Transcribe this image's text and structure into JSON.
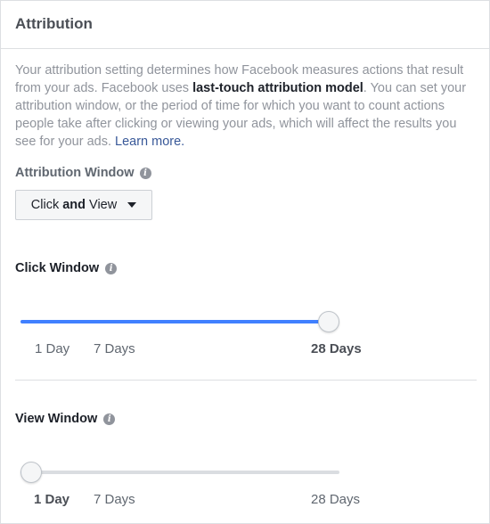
{
  "header": {
    "title": "Attribution"
  },
  "description": {
    "text_before": "Your attribution setting determines how Facebook measures actions that result from your ads. Facebook uses ",
    "bold_text": "last-touch attribution model",
    "text_after": ". You can set your attribution window, or the period of time for which you want to count actions people take after clicking or viewing your ads, which will affect the results you see for your ads. ",
    "link_text": "Learn more."
  },
  "attribution_window": {
    "label": "Attribution Window",
    "dropdown": {
      "part1": "Click ",
      "bold": "and",
      "part2": " View"
    }
  },
  "click_window": {
    "title": "Click Window",
    "value_fraction": 1.0,
    "selected": "28 Days",
    "ticks": [
      "1 Day",
      "7 Days",
      "28 Days"
    ]
  },
  "view_window": {
    "title": "View Window",
    "value_fraction": 0.0,
    "selected": "1 Day",
    "ticks": [
      "1 Day",
      "7 Days",
      "28 Days"
    ]
  },
  "colors": {
    "accent": "#4080ff",
    "link": "#385898",
    "muted_text": "#90949c",
    "border": "#dddfe2"
  }
}
